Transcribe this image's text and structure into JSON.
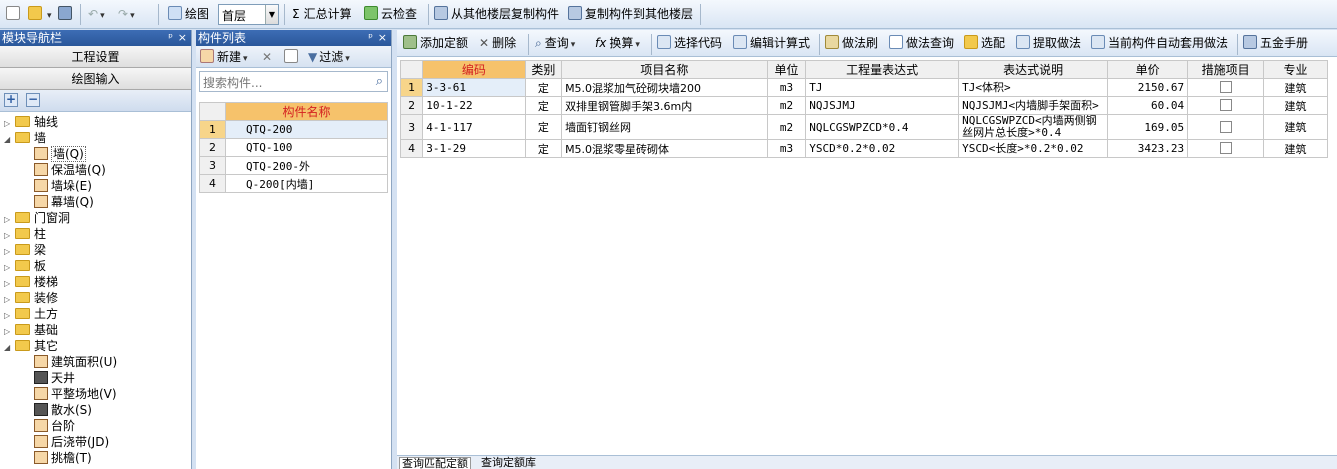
{
  "toolbar": {
    "draw_label": "绘图",
    "floor_value": "首层",
    "sum_label": "汇总计算",
    "cloud_check_label": "云检查",
    "copy_from_floor_label": "从其他楼层复制构件",
    "copy_to_floor_label": "复制构件到其他楼层"
  },
  "nav": {
    "title": "模块导航栏",
    "project_settings": "工程设置",
    "drawing_input": "绘图输入",
    "tree": [
      {
        "label": "轴线",
        "level": 0,
        "expanded": false
      },
      {
        "label": "墙",
        "level": 0,
        "expanded": true
      },
      {
        "label": "墙(Q)",
        "level": 1,
        "selected": true
      },
      {
        "label": "保温墙(Q)",
        "level": 1
      },
      {
        "label": "墙垛(E)",
        "level": 1
      },
      {
        "label": "幕墙(Q)",
        "level": 1
      },
      {
        "label": "门窗洞",
        "level": 0,
        "expanded": false
      },
      {
        "label": "柱",
        "level": 0,
        "expanded": false
      },
      {
        "label": "梁",
        "level": 0,
        "expanded": false
      },
      {
        "label": "板",
        "level": 0,
        "expanded": false
      },
      {
        "label": "楼梯",
        "level": 0,
        "expanded": false
      },
      {
        "label": "装修",
        "level": 0,
        "expanded": false
      },
      {
        "label": "土方",
        "level": 0,
        "expanded": false
      },
      {
        "label": "基础",
        "level": 0,
        "expanded": false
      },
      {
        "label": "其它",
        "level": 0,
        "expanded": true
      },
      {
        "label": "建筑面积(U)",
        "level": 1
      },
      {
        "label": "天井",
        "level": 1
      },
      {
        "label": "平整场地(V)",
        "level": 1
      },
      {
        "label": "散水(S)",
        "level": 1
      },
      {
        "label": "台阶",
        "level": 1
      },
      {
        "label": "后浇带(JD)",
        "level": 1
      },
      {
        "label": "挑檐(T)",
        "level": 1
      }
    ]
  },
  "components": {
    "title": "构件列表",
    "new_label": "新建",
    "filter_label": "过滤",
    "search_placeholder": "搜索构件...",
    "col_name": "构件名称",
    "rows": [
      {
        "num": "1",
        "name": "QTQ-200",
        "selected": true
      },
      {
        "num": "2",
        "name": "QTQ-100"
      },
      {
        "num": "3",
        "name": "QTQ-200-外"
      },
      {
        "num": "4",
        "name": "Q-200[内墙]"
      }
    ]
  },
  "main": {
    "tools": {
      "add_quota": "添加定额",
      "delete": "删除",
      "query": "查询",
      "convert": "换算",
      "select_code": "选择代码",
      "edit_formula": "编辑计算式",
      "method_brush": "做法刷",
      "method_query": "做法查询",
      "select_match": "选配",
      "extract_method": "提取做法",
      "auto_apply": "当前构件自动套用做法",
      "hardware_manual": "五金手册"
    },
    "columns": [
      "编码",
      "类别",
      "项目名称",
      "单位",
      "工程量表达式",
      "表达式说明",
      "单价",
      "措施项目",
      "专业"
    ],
    "rows": [
      {
        "num": "1",
        "code": "3-3-61",
        "type": "定",
        "name": "M5.0混浆加气砼砌块墙200",
        "unit": "m3",
        "expr": "TJ",
        "desc": "TJ<体积>",
        "price": "2150.67",
        "measure": false,
        "major": "建筑"
      },
      {
        "num": "2",
        "code": "10-1-22",
        "type": "定",
        "name": "双排里钢管脚手架3.6m内",
        "unit": "m2",
        "expr": "NQJSJMJ",
        "desc": "NQJSJMJ<内墙脚手架面积>",
        "price": "60.04",
        "measure": false,
        "major": "建筑"
      },
      {
        "num": "3",
        "code": "4-1-117",
        "type": "定",
        "name": "墙面钉钢丝网",
        "unit": "m2",
        "expr": "NQLCGSWPZCD*0.4",
        "desc": "NQLCGSWPZCD<内墙两侧钢丝网片总长度>*0.4",
        "price": "169.05",
        "measure": false,
        "major": "建筑"
      },
      {
        "num": "4",
        "code": "3-1-29",
        "type": "定",
        "name": "M5.0混浆零星砖砌体",
        "unit": "m3",
        "expr": "YSCD*0.2*0.02",
        "desc": "YSCD<长度>*0.2*0.02",
        "price": "3423.23",
        "measure": false,
        "major": "建筑"
      }
    ],
    "bottom_tabs": [
      "查询匹配定额",
      "查询定额库"
    ]
  }
}
